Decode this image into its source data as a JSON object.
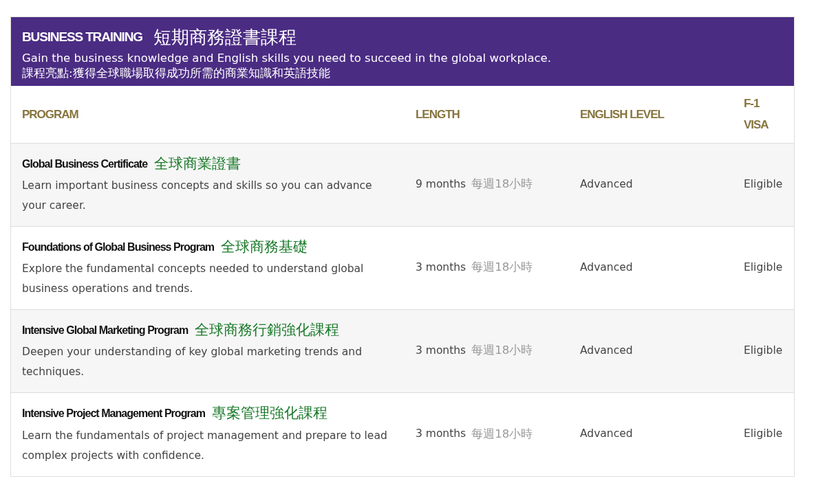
{
  "banner": {
    "title": "BUSINESS TRAINING",
    "title_zh": "短期商務證書課程",
    "subtitle": "Gain the business knowledge and English skills you need to succeed in the global workplace.",
    "subtitle_zh": "課程亮點:獲得全球職場取得成功所需的商業知識和英語技能"
  },
  "table": {
    "columns": [
      "PROGRAM",
      "LENGTH",
      "ENGLISH LEVEL",
      "F-1 VISA"
    ],
    "rows": [
      {
        "name": "Global Business Certificate",
        "name_zh": "全球商業證書",
        "description": "Learn important business concepts and skills so you can advance your career.",
        "length": "9 months",
        "length_zh": "每週18小時",
        "english_level": "Advanced",
        "visa": "Eligible"
      },
      {
        "name": "Foundations of Global Business Program",
        "name_zh": "全球商務基礎",
        "description": "Explore the fundamental concepts needed to understand global business operations and trends.",
        "length": "3 months",
        "length_zh": "每週18小時",
        "english_level": "Advanced",
        "visa": "Eligible"
      },
      {
        "name": "Intensive Global Marketing Program",
        "name_zh": "全球商務行銷強化課程",
        "description": "Deepen your understanding of key global marketing trends and techniques.",
        "length": "3 months",
        "length_zh": "每週18小時",
        "english_level": "Advanced",
        "visa": "Eligible"
      },
      {
        "name": "Intensive Project Management Program",
        "name_zh": "專案管理強化課程",
        "description": "Learn the fundamentals of project management and prepare to lead complex projects with confidence.",
        "length": "3 months",
        "length_zh": "每週18小時",
        "english_level": "Advanced",
        "visa": "Eligible"
      }
    ]
  }
}
